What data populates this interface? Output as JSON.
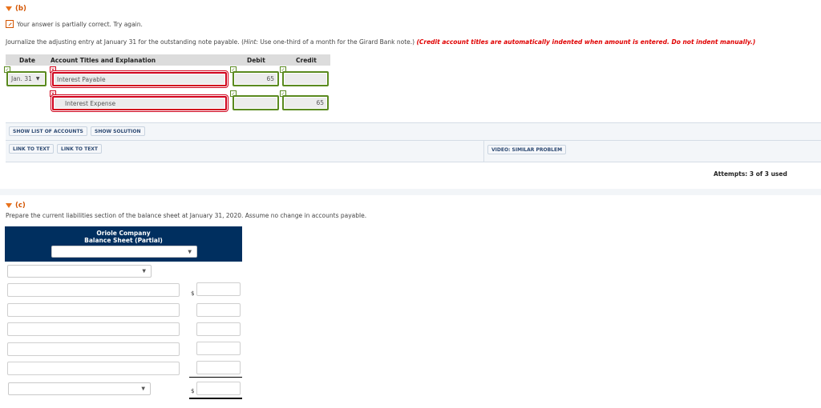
{
  "part_b": {
    "label": "(b)",
    "feedback": "Your answer is partially correct.  Try again.",
    "instructions": {
      "main": "Journalize the adjusting entry at January 31 for the outstanding note payable. (",
      "hint_label": "Hint:",
      "hint_text": " Use one-third of a month for the Girard Bank note.) ",
      "warning": "(Credit account titles are automatically indented when amount is entered. Do not indent manually.)"
    },
    "table": {
      "headers": {
        "date": "Date",
        "account": "Account Titles and Explanation",
        "debit": "Debit",
        "credit": "Credit"
      },
      "rows": [
        {
          "date": "Jan. 31",
          "account": "Interest Payable",
          "debit": "65",
          "credit": "",
          "date_status": "correct",
          "account_status": "incorrect",
          "debit_status": "correct",
          "credit_status": "correct"
        },
        {
          "date": "",
          "account": "Interest Expense",
          "debit": "",
          "credit": "65",
          "account_status": "incorrect",
          "debit_status": "correct",
          "credit_status": "correct"
        }
      ]
    },
    "buttons": {
      "show_accounts": "SHOW LIST OF ACCOUNTS",
      "show_solution": "SHOW SOLUTION",
      "link_text_1": "LINK TO TEXT",
      "link_text_2": "LINK TO TEXT",
      "video": "VIDEO: SIMILAR PROBLEM"
    },
    "attempts": "Attempts: 3 of 3 used"
  },
  "part_c": {
    "label": "(c)",
    "instructions": "Prepare the current liabilities section of the balance sheet at January 31, 2020. Assume no change in accounts payable.",
    "balance_sheet": {
      "company": "Oriole Company",
      "title": "Balance Sheet (Partial)",
      "date_select": "",
      "section_select": "",
      "line_items": [
        "",
        "",
        "",
        "",
        ""
      ],
      "amounts": [
        "",
        "",
        "",
        "",
        ""
      ],
      "total_select": "",
      "total_amount": "",
      "currency_symbol": "$"
    }
  },
  "icons": {
    "check": "✓",
    "cross": "✕",
    "dropdown": "▼"
  },
  "colors": {
    "accent_orange": "#e8721c",
    "correct_green": "#5a8a1f",
    "incorrect_red": "#d0021b",
    "warning_red": "#e00000",
    "header_navy": "#002f5f",
    "button_text": "#2d4a73"
  }
}
